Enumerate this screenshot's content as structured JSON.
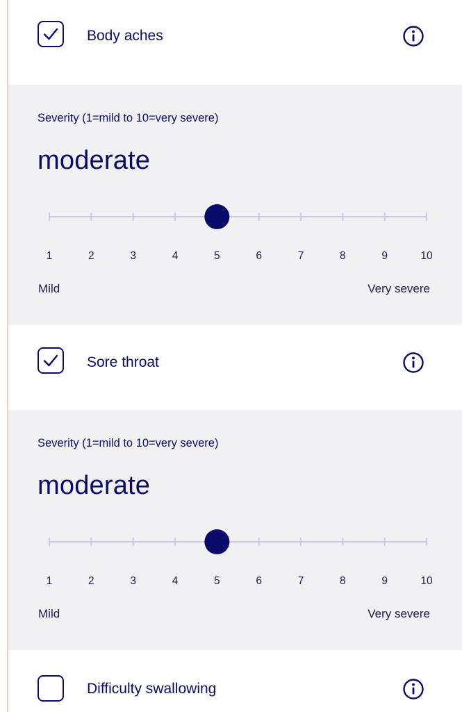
{
  "colors": {
    "primary": "#0a0a6b",
    "panel_bg": "#f1f0f2",
    "track": "#c9c9e6",
    "accent_line": "#f0d2c0"
  },
  "symptoms": [
    {
      "label": "Body aches",
      "checked": true,
      "info_icon": "info-circle-icon",
      "severity": {
        "label": "Severity (1=mild to 10=very severe)",
        "value_text": "moderate",
        "value": 5,
        "min": 1,
        "max": 10,
        "ticks": [
          "1",
          "2",
          "3",
          "4",
          "5",
          "6",
          "7",
          "8",
          "9",
          "10"
        ],
        "min_label": "Mild",
        "max_label": "Very severe"
      }
    },
    {
      "label": "Sore throat",
      "checked": true,
      "info_icon": "info-circle-icon",
      "severity": {
        "label": "Severity (1=mild to 10=very severe)",
        "value_text": "moderate",
        "value": 5,
        "min": 1,
        "max": 10,
        "ticks": [
          "1",
          "2",
          "3",
          "4",
          "5",
          "6",
          "7",
          "8",
          "9",
          "10"
        ],
        "min_label": "Mild",
        "max_label": "Very severe"
      }
    },
    {
      "label": "Difficulty swallowing",
      "checked": false,
      "info_icon": "info-circle-icon"
    }
  ]
}
